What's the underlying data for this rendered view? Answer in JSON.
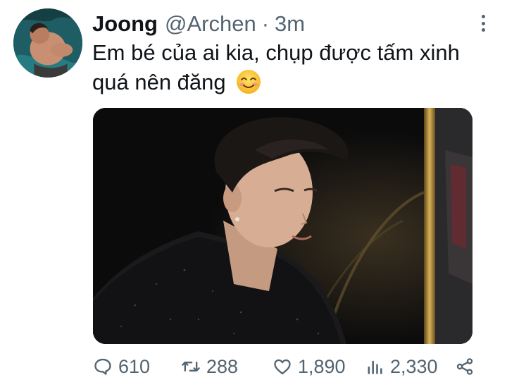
{
  "tweet": {
    "author_name": "Joong",
    "handle": "@Archen",
    "separator": "·",
    "time": "3m",
    "text": "Em bé của ai kia, chụp được tấm xinh quá nên đăng",
    "emoji": "smiling-face-icon"
  },
  "actions": {
    "replies": "610",
    "retweets": "288",
    "likes": "1,890",
    "views": "2,330"
  },
  "icons": {
    "more": "more-vertical-icon",
    "reply": "speech-bubble-icon",
    "retweet": "retweet-icon",
    "like": "heart-icon",
    "views": "bar-chart-icon",
    "share": "share-icon"
  },
  "colors": {
    "text": "#0f1419",
    "secondary": "#536471",
    "background": "#ffffff"
  }
}
